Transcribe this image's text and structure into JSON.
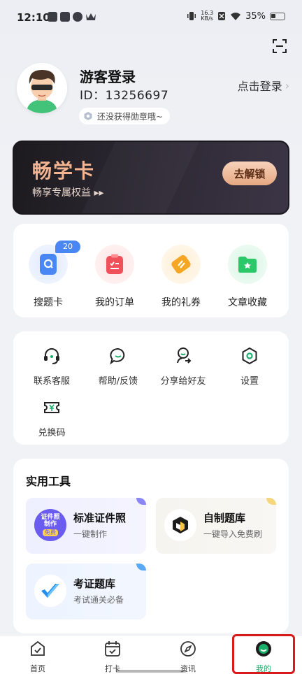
{
  "status_bar": {
    "time": "12:10",
    "net_speed_value": "16.3",
    "net_speed_unit": "KB/s",
    "battery": "35%"
  },
  "profile": {
    "name": "游客登录",
    "id_text": "ID：13256697",
    "badge_text": "还没获得勋章哦~",
    "login_label": "点击登录",
    "chevron": "›"
  },
  "vip": {
    "title": "畅学卡",
    "subtitle": "畅享专属权益 ▸▸",
    "unlock_label": "去解锁"
  },
  "quick_actions": [
    {
      "label": "搜题卡",
      "badge": "20",
      "icon": "search-card-icon",
      "color": "#4a87f5"
    },
    {
      "label": "我的订单",
      "icon": "order-list-icon",
      "color": "#f0505a"
    },
    {
      "label": "我的礼券",
      "icon": "coupon-icon",
      "color": "#f5a623"
    },
    {
      "label": "文章收藏",
      "icon": "folder-star-icon",
      "color": "#2bc86a"
    }
  ],
  "services": [
    {
      "label": "联系客服",
      "icon": "headset-icon"
    },
    {
      "label": "帮助/反馈",
      "icon": "chat-bubble-icon"
    },
    {
      "label": "分享给好友",
      "icon": "share-person-icon"
    },
    {
      "label": "设置",
      "icon": "hex-gear-icon"
    },
    {
      "label": "兑换码",
      "icon": "ticket-yen-icon"
    }
  ],
  "tools": {
    "title": "实用工具",
    "items": [
      {
        "title": "标准证件照",
        "subtitle": "一键制作",
        "logo_line1": "证件照",
        "logo_line2": "制作",
        "logo_tag": "免费",
        "accent": "#8b86f5"
      },
      {
        "title": "自制题库",
        "subtitle": "一键导入免费刷",
        "accent": "#f5d67a"
      },
      {
        "title": "考证题库",
        "subtitle": "考试通关必备",
        "accent": "#5aa9f7"
      }
    ]
  },
  "tabbar": {
    "tabs": [
      {
        "label": "首页",
        "icon": "home-check-icon"
      },
      {
        "label": "打卡",
        "icon": "calendar-check-icon"
      },
      {
        "label": "资讯",
        "icon": "compass-icon"
      },
      {
        "label": "我的",
        "icon": "profile-face-icon"
      }
    ],
    "active_index": 3,
    "active_color": "#18b06a"
  }
}
